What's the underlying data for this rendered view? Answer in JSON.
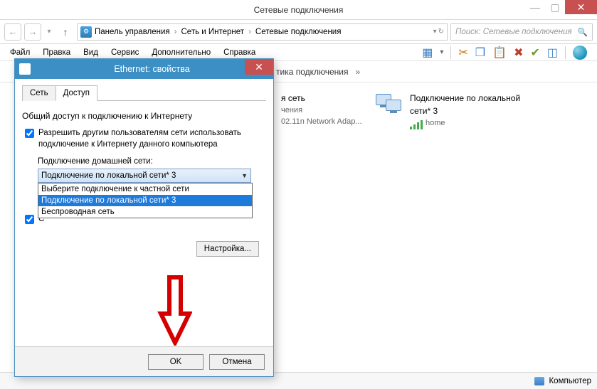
{
  "window": {
    "title": "Сетевые подключения",
    "controls": {
      "min": "—",
      "max": "▢",
      "close": "✕"
    }
  },
  "nav": {
    "back": "←",
    "forward": "→",
    "dropdown": "▾",
    "up": "↑",
    "crumb1": "Панель управления",
    "crumb2": "Сеть и Интернет",
    "crumb3": "Сетевые подключения",
    "sep": "›",
    "refresh": "↻",
    "search_placeholder": "Поиск: Сетевые подключения",
    "search_icon": "🔍"
  },
  "menu": {
    "file": "Файл",
    "edit": "Правка",
    "view": "Вид",
    "service": "Сервис",
    "extra": "Дополнительно",
    "help": "Справка"
  },
  "toolbar_icons": {
    "layout": "▦",
    "details": "▾",
    "cut": "✂",
    "copy": "❐",
    "paste": "📋",
    "delete": "✖",
    "check": "✔",
    "props": "◫",
    "help": "?"
  },
  "cmdbar": {
    "diag": "тика подключения",
    "chevron": "»"
  },
  "connections": {
    "item1": {
      "name": "я сеть",
      "line2": "чения",
      "line3": "02.11n Network Adap..."
    },
    "item2": {
      "name": "Подключение по локальной",
      "line2": "сети* 3",
      "line3": "home"
    }
  },
  "statusbar": {
    "left": "",
    "computer": "Компьютер"
  },
  "dialog": {
    "title": "Ethernet: свойства",
    "close": "✕",
    "tabs": {
      "network": "Сеть",
      "access": "Доступ"
    },
    "group_title": "Общий доступ к подключению к Интернету",
    "chk1": "Разрешить другим пользователям сети использовать подключение к Интернету данного компьютера",
    "sub_label": "Подключение домашней сети:",
    "combo_value": "Подключение по локальной сети* 3",
    "options": {
      "opt1": "Выберите подключение к частной сети",
      "opt2": "Подключение по локальной сети* 3",
      "opt3": "Беспроводная сеть"
    },
    "chk2_visible_fragment": "С",
    "settings_btn": "Настройка...",
    "ok": "OK",
    "cancel": "Отмена"
  }
}
